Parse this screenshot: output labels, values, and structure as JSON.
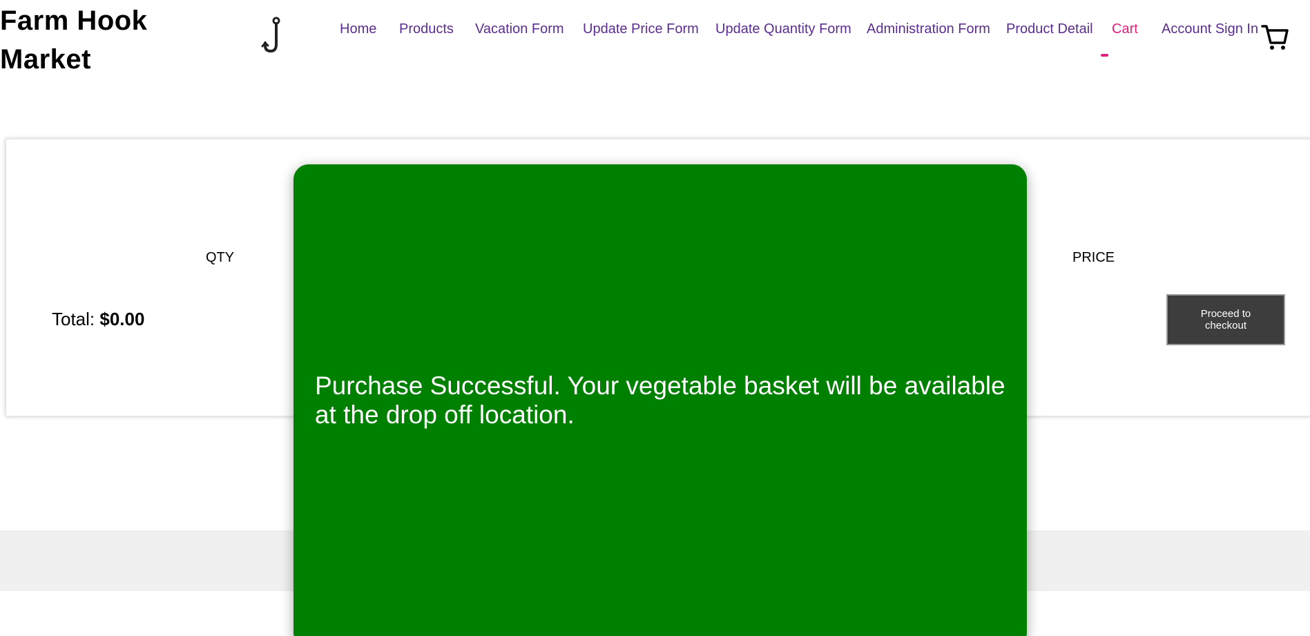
{
  "brand": {
    "name": "Farm Hook Market"
  },
  "nav": {
    "items": [
      {
        "label": "Home"
      },
      {
        "label": "Products"
      },
      {
        "label": "Vacation Form"
      },
      {
        "label": "Update Price Form"
      },
      {
        "label": "Update Quantity Form"
      },
      {
        "label": "Administration Form"
      },
      {
        "label": "Product Detail"
      },
      {
        "label": "Cart",
        "active": true
      },
      {
        "label": "Account Sign In"
      }
    ],
    "active_color": "#e0207a",
    "link_color": "#5b2d8e"
  },
  "icons": {
    "logo": "fish-hook-icon",
    "cart": "shopping-cart-icon"
  },
  "cart": {
    "columns": {
      "qty": "QTY",
      "price": "PRICE"
    },
    "total_label": "Total:",
    "total_value": "$0.00",
    "checkout_label": "Proceed to checkout"
  },
  "modal": {
    "message": "Purchase Successful. Your vegetable basket will be available at the drop off location.",
    "background": "#008000"
  }
}
